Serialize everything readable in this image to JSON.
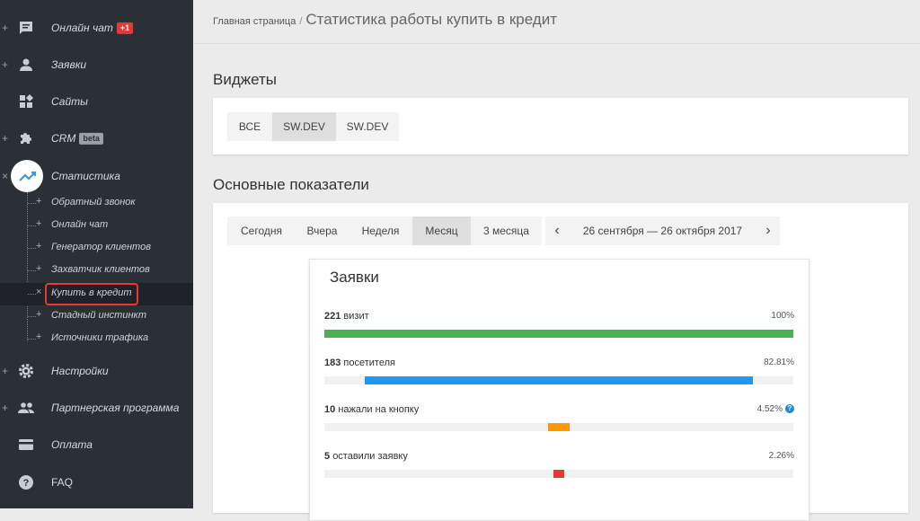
{
  "sidebar": {
    "items": [
      {
        "label": "Онлайн чат",
        "badge": "+1",
        "icon": "chat-icon",
        "expand": "+"
      },
      {
        "label": "Заявки",
        "icon": "user-icon",
        "expand": "+"
      },
      {
        "label": "Сайты",
        "icon": "widgets-icon"
      },
      {
        "label": "CRM",
        "badge": "beta",
        "icon": "puzzle-icon",
        "expand": "+"
      },
      {
        "label": "Статистика",
        "icon": "trending-up-icon",
        "expand": "×"
      }
    ],
    "sub_items": [
      {
        "label": "Обратный звонок",
        "marker": "+"
      },
      {
        "label": "Онлайн чат",
        "marker": "+"
      },
      {
        "label": "Генератор клиентов",
        "marker": "+"
      },
      {
        "label": "Захватчик клиентов",
        "marker": "+"
      },
      {
        "label": "Купить в кредит",
        "marker": "×",
        "active": true
      },
      {
        "label": "Стадный инстинкт",
        "marker": "+"
      },
      {
        "label": "Источники трафика",
        "marker": "+"
      }
    ],
    "bottom_items": [
      {
        "label": "Настройки",
        "icon": "gear-icon",
        "expand": "+"
      },
      {
        "label": "Партнерская программа",
        "icon": "people-icon",
        "expand": "+"
      },
      {
        "label": "Оплата",
        "icon": "card-icon"
      },
      {
        "label": "FAQ",
        "icon": "help-icon"
      }
    ]
  },
  "breadcrumb": {
    "home": "Главная страница",
    "separator": "/",
    "title": "Статистика работы купить в кредит"
  },
  "widgets": {
    "heading": "Виджеты",
    "tabs": [
      {
        "label": "ВСЕ"
      },
      {
        "label": "SW.DEV",
        "selected": true
      },
      {
        "label": "SW.DEV"
      }
    ]
  },
  "metrics": {
    "heading": "Основные показатели",
    "periods": [
      {
        "label": "Сегодня"
      },
      {
        "label": "Вчера"
      },
      {
        "label": "Неделя"
      },
      {
        "label": "Месяц",
        "selected": true
      },
      {
        "label": "3 месяца"
      }
    ],
    "date_prev": "‹",
    "date_range": "26 сентября — 26 октября 2017",
    "date_next": "›"
  },
  "card": {
    "title": "Заявки",
    "rows": [
      {
        "count": "221",
        "text": "визит",
        "pct": "100%",
        "start": 0,
        "fraction": 1.0,
        "color": "#4caf50"
      },
      {
        "count": "183",
        "text": "посетителя",
        "pct": "82.81%",
        "start": 0.0857,
        "fraction": 0.8281,
        "color": "#2196f3"
      },
      {
        "count": "10",
        "text": "нажали на кнопку",
        "pct": "4.52%",
        "start": 0.4774,
        "fraction": 0.0452,
        "color": "#ff9800",
        "help": "?"
      },
      {
        "count": "5",
        "text": "оставили заявку",
        "pct": "2.26%",
        "start": 0.4887,
        "fraction": 0.0226,
        "color": "#e53935"
      }
    ]
  }
}
